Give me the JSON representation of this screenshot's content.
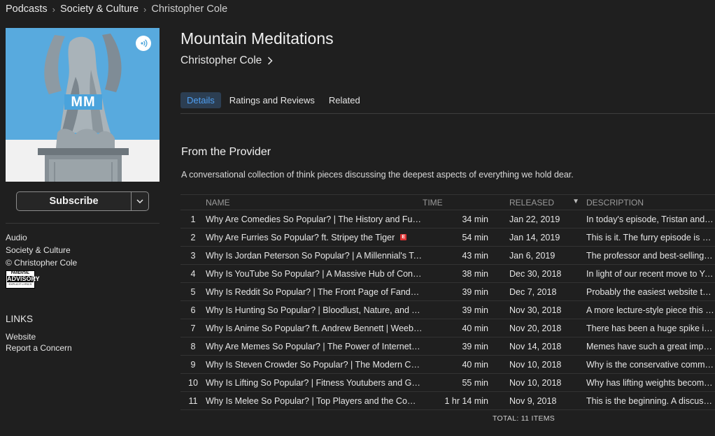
{
  "breadcrumb": [
    "Podcasts",
    "Society & Culture",
    "Christopher Cole"
  ],
  "artwork": {
    "logo_text": "MM"
  },
  "subscribe": {
    "label": "Subscribe"
  },
  "side_info": {
    "type": "Audio",
    "genre": "Society & Culture",
    "copyright": "© Christopher Cole"
  },
  "advisory": {
    "line1": "PARENTAL",
    "line2": "ADVISORY",
    "line3": "EXPLICIT LYRICS"
  },
  "links": {
    "heading": "LINKS",
    "items": [
      "Website",
      "Report a Concern"
    ]
  },
  "podcast": {
    "title": "Mountain Meditations",
    "author": "Christopher Cole"
  },
  "tabs": [
    {
      "label": "Details",
      "active": true
    },
    {
      "label": "Ratings and Reviews",
      "active": false
    },
    {
      "label": "Related",
      "active": false
    }
  ],
  "provider": {
    "title": "From the Provider",
    "description": "A conversational collection of think pieces discussing the deepest aspects of everything we hold dear."
  },
  "table": {
    "columns": [
      "NAME",
      "TIME",
      "RELEASED",
      "DESCRIPTION"
    ],
    "sort_indicator": "▼",
    "rows": [
      {
        "num": "1",
        "name": "Why Are Comedies So Popular? | The History and Future of Comedy",
        "explicit": false,
        "time": "34 min",
        "released": "Jan 22, 2019",
        "description": "In today's episode, Tristan and I discuss"
      },
      {
        "num": "2",
        "name": "Why Are Furries So Popular? ft. Stripey the Tiger",
        "explicit": true,
        "explicit_label": "E",
        "time": "54 min",
        "released": "Jan 14, 2019",
        "description": "This is it. The furry episode is here"
      },
      {
        "num": "3",
        "name": "Why Is Jordan Peterson So Popular? | A Millennial's Take",
        "explicit": false,
        "time": "43 min",
        "released": "Jan 6, 2019",
        "description": "The professor and best-selling author"
      },
      {
        "num": "4",
        "name": "Why Is YouTube So Popular? | A Massive Hub of Content",
        "explicit": false,
        "time": "38 min",
        "released": "Dec 30, 2018",
        "description": "In light of our recent move to YouTube"
      },
      {
        "num": "5",
        "name": "Why Is Reddit So Popular? | The Front Page of Fandom",
        "explicit": false,
        "time": "39 min",
        "released": "Dec 7, 2018",
        "description": "Probably the easiest website to waste time on"
      },
      {
        "num": "6",
        "name": "Why Is Hunting So Popular? | Bloodlust, Nature, and Tradition",
        "explicit": false,
        "time": "39 min",
        "released": "Nov 30, 2018",
        "description": "A more lecture-style piece this week"
      },
      {
        "num": "7",
        "name": "Why Is Anime So Popular? ft. Andrew Bennett | Weebs Rejoice",
        "explicit": false,
        "time": "40 min",
        "released": "Nov 20, 2018",
        "description": "There has been a huge spike in anime"
      },
      {
        "num": "8",
        "name": "Why Are Memes So Popular? | The Power of Internet Culture",
        "explicit": false,
        "time": "39 min",
        "released": "Nov 14, 2018",
        "description": "Memes have such a great impact on us"
      },
      {
        "num": "9",
        "name": "Why Is Steven Crowder So Popular? | The Modern Conservative",
        "explicit": false,
        "time": "40 min",
        "released": "Nov 10, 2018",
        "description": "Why is the conservative commentator"
      },
      {
        "num": "10",
        "name": "Why Is Lifting So Popular? | Fitness Youtubers and Gym Culture",
        "explicit": false,
        "time": "55 min",
        "released": "Nov 10, 2018",
        "description": "Why has lifting weights become so popular"
      },
      {
        "num": "11",
        "name": "Why Is Melee So Popular? | Top Players and the Community",
        "explicit": false,
        "time": "1 hr 14 min",
        "released": "Nov 9, 2018",
        "description": "This is the beginning. A discussion of Melee"
      }
    ],
    "total": "TOTAL: 11 ITEMS"
  }
}
